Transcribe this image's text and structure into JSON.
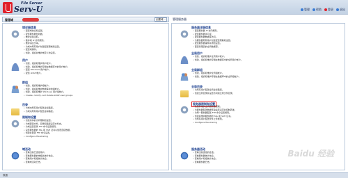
{
  "header": {
    "logo_small": "File Server",
    "logo_name": "Serv-U",
    "links": [
      {
        "label": "管理",
        "icon": "home-icon",
        "color": "#3a7bd5"
      },
      {
        "label": "帮助",
        "icon": "help-icon",
        "color": "#3a7bd5"
      },
      {
        "label": "登录",
        "icon": "login-icon",
        "color": "#e0202a"
      },
      {
        "label": "退出",
        "icon": "logout-icon",
        "color": "#3a7bd5"
      }
    ]
  },
  "left_header": {
    "title": "管理域",
    "select_value": "创建域..."
  },
  "right_header": {
    "title": "管理服务器"
  },
  "left_sections": [
    {
      "title": "域详细信息",
      "icon": "gear-icon",
      "items": [
        "配置域信息和设置。",
        "配置服务器监听器。",
        "维护虚拟主机。",
        "维护域 IP 访问规则。",
        "维护消息文本。",
        "为域中所有用户创建配置限制和设置。",
        "配置域事件。",
        "创建、组织并维护域定义的设置。"
      ]
    },
    {
      "title": "用户",
      "icon": "user-icon",
      "items": [
        "创建、组织和维护用户帐户。",
        "创建、组织和维护存储在数据库中的用户帐户。",
        "配置 Windows 用户帐户。",
        "配置 LDAP 帐户。"
      ]
    },
    {
      "title": "群组",
      "icon": "group-icon",
      "items": [
        "创建、组织和维护组帐户。",
        "创建、组织和维护数据库中的组帐户。",
        "创建、组织和维护 Windows 用户组帐户。",
        "Create, modify, and delete LDAP user groups"
      ]
    },
    {
      "title": "目录",
      "icon": "folder-icon",
      "items": [
        "为域内所有用户配置虚拟路径。",
        "为域内所有用户配置虚拟路径。"
      ]
    },
    {
      "title": "限制和设置",
      "icon": "gear-icon",
      "items": [
        "创建具体的访问限制和设置。",
        "为域配置文件、目录和路径设定文件夹。",
        "为域设置目录 FTP 命令设置规则。",
        "设置服务器的 SSL 和 SSH 证书以加密连接数据。",
        "创建并配置 FTP 命令设置。",
        "Configure file sharing"
      ]
    },
    {
      "title": "域活动",
      "icon": "net-icon",
      "items": [
        "查看当前已连接用户。",
        "查看服务器的域相关统计信息。",
        "查看用户和组统计信息。",
        "查看域活动日志。"
      ]
    }
  ],
  "right_sections": [
    {
      "title": "服务器详细信息",
      "icon": "gear-icon",
      "items": [
        "配置服务器 IP 访问规则。",
        "配置服务器许可证。",
        "配置服务器数据库访问。",
        "为服务器所有用户创建配置限制和设置。",
        "配置服务器事件并通知设置。",
        "配置管理员的全局数据源。"
      ]
    },
    {
      "title": "全局用户",
      "icon": "user-icon",
      "items": [
        "创建、组织和维护全局用户帐户。",
        "创建、组织和维护存储在数据库中的全局用户帐户。"
      ]
    },
    {
      "title": "全局群组",
      "icon": "group-icon",
      "items": [
        "创建、组织和维护全局组帐户。",
        "创建、组织和维护存储在数据库中的全局组帐户。"
      ]
    },
    {
      "title": "全局目录",
      "icon": "folder-icon",
      "items": [
        "为所有用户配置全局虚拟路径。",
        "创建全局目录并设置访问和全局文件目录。"
      ]
    },
    {
      "title": "服务器限制和设置",
      "icon": "gear-icon",
      "items": [
        "创建并维护全局服务器限制。",
        "为服务器配置数据传输速率设定并控制转发。",
        "为每一服务器配置 FTP 命令设置规则。",
        "创建并维护服务器的 SSL 和 SSH 证书。",
        "为所有用户配置文件上传规则。",
        "Configure file sharing"
      ]
    },
    {
      "title": "服务器活动",
      "icon": "net-icon",
      "items": [
        "查看当前连接的会话。",
        "查看服务器统计信息。",
        "查看用户和组统计信息。",
        "查看服务器日志。"
      ]
    }
  ],
  "status": {
    "text": "就绪"
  },
  "watermark": "Baidu 经验"
}
